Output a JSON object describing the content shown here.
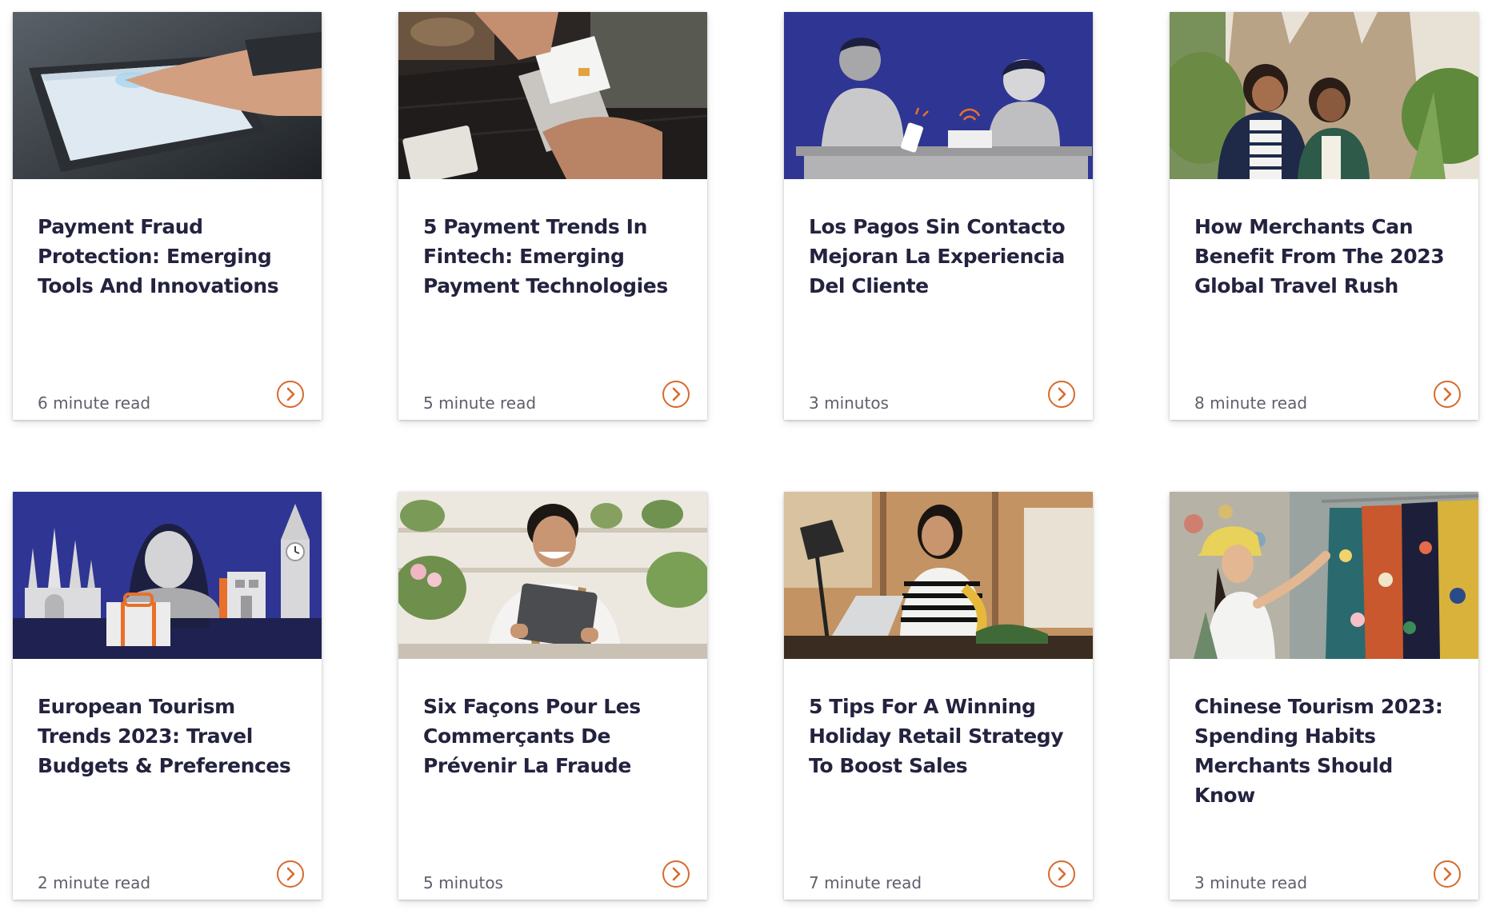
{
  "accent_color": "#d86a2c",
  "cards": [
    {
      "title": "Payment Fraud Protection: Emerging Tools And Innovations",
      "read_time": "6 minute read",
      "image": "hand-touching-payment-terminal-photo"
    },
    {
      "title": "5 Payment Trends In Fintech: Emerging Payment Technologies",
      "read_time": "5 minute read",
      "image": "card-tapped-on-phone-photo"
    },
    {
      "title": "Los Pagos Sin Contacto Mejoran La Experiencia Del Cliente",
      "read_time": "3 minutos",
      "image": "contactless-checkout-illustration"
    },
    {
      "title": "How Merchants Can Benefit From The 2023 Global Travel Rush",
      "read_time": "8 minute read",
      "image": "travelers-in-city-photo"
    },
    {
      "title": "European Tourism Trends 2023: Travel Budgets & Preferences",
      "read_time": "2 minute read",
      "image": "european-landmarks-illustration"
    },
    {
      "title": "Six Façons Pour Les Commerçants De Prévenir La Fraude",
      "read_time": "5 minutos",
      "image": "shop-owner-with-tablet-photo"
    },
    {
      "title": "5 Tips For A Winning Holiday Retail Strategy To Boost Sales",
      "read_time": "7 minute read",
      "image": "woman-working-at-desk-photo"
    },
    {
      "title": "Chinese Tourism 2023: Spending Habits Merchants Should Know",
      "read_time": "3 minute read",
      "image": "tourist-browsing-clothes-photo"
    }
  ]
}
